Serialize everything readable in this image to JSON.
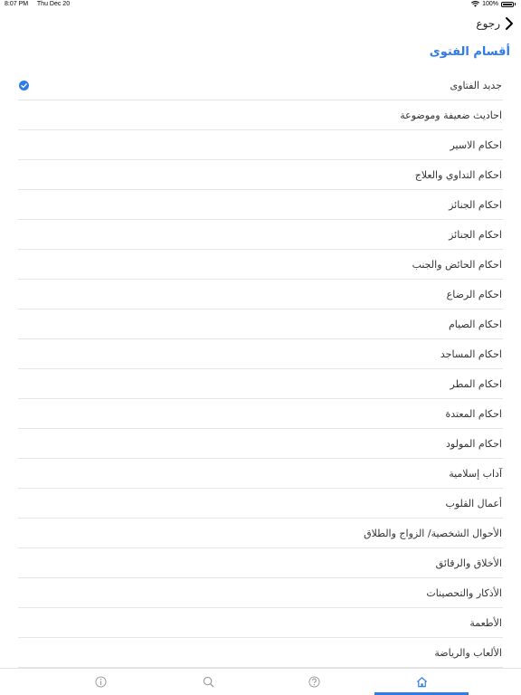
{
  "status_bar": {
    "time": "8:07 PM",
    "date": "Thu Dec 20",
    "battery": "100%"
  },
  "nav": {
    "back_label": "رجوع"
  },
  "section": {
    "title": "أقسام الفتوى"
  },
  "items": [
    {
      "label": "جديد الفتاوى",
      "checked": true
    },
    {
      "label": "احاديث ضعيفة وموضوعة"
    },
    {
      "label": "احكام الاسير"
    },
    {
      "label": "احكام التداوي والعلاج"
    },
    {
      "label": "احكام الجنائز"
    },
    {
      "label": "احكام الجنائز"
    },
    {
      "label": "احكام الحائض والجنب"
    },
    {
      "label": "احكام الرضاع"
    },
    {
      "label": "احكام الصيام"
    },
    {
      "label": "احكام المساجد"
    },
    {
      "label": "احكام المطر"
    },
    {
      "label": "احكام المعتدة"
    },
    {
      "label": "احكام المولود"
    },
    {
      "label": "آداب إسلامية"
    },
    {
      "label": "أعمال القلوب"
    },
    {
      "label": "الأحوال الشخصية/ الزواج والطلاق"
    },
    {
      "label": "الأخلاق والرقائق"
    },
    {
      "label": "الأذكار والتحصينات"
    },
    {
      "label": "الأطعمة"
    },
    {
      "label": "الألعاب والرياضة"
    }
  ],
  "tabs": [
    {
      "icon": "info-icon"
    },
    {
      "icon": "search-icon"
    },
    {
      "icon": "help-icon"
    },
    {
      "icon": "home-icon",
      "active": true
    }
  ],
  "colors": {
    "accent": "#2f7be8"
  }
}
